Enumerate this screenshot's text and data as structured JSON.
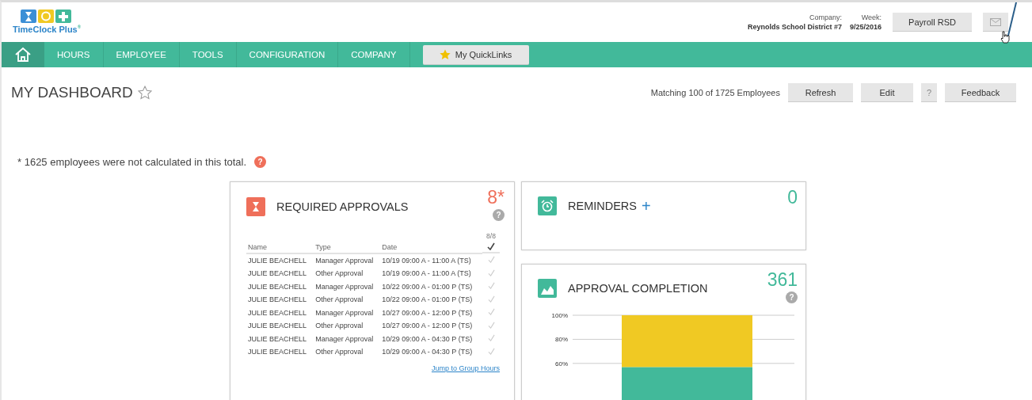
{
  "logo": {
    "text": "TimeClock Plus",
    "mark": "®"
  },
  "header": {
    "company_label": "Company:",
    "company": "Reynolds School District #7",
    "week_label": "Week:",
    "week": "9/25/2016",
    "payroll_button": "Payroll RSD"
  },
  "nav": {
    "items": [
      {
        "label": "HOURS",
        "selected": false
      },
      {
        "label": "EMPLOYEE",
        "selected": false
      },
      {
        "label": "TOOLS",
        "selected": false
      },
      {
        "label": "CONFIGURATION",
        "selected": false
      },
      {
        "label": "COMPANY",
        "selected": false
      }
    ],
    "quicklinks": "My QuickLinks"
  },
  "page": {
    "title": "MY DASHBOARD",
    "matching": "Matching 100 of 1725 Employees",
    "buttons": [
      "Refresh",
      "Edit",
      "?",
      "Feedback"
    ],
    "note": "* 1625 employees were not calculated in this total.",
    "help": "?"
  },
  "approvals": {
    "title": "REQUIRED APPROVALS",
    "count": "8*",
    "help": "?",
    "columns": [
      "Name",
      "Type",
      "Date"
    ],
    "check_count": "8/8",
    "rows": [
      {
        "name": "JULIE BEACHELL",
        "type": "Manager Approval",
        "date": "10/19 09:00 A - 11:00 A (TS)"
      },
      {
        "name": "JULIE BEACHELL",
        "type": "Other Approval",
        "date": "10/19 09:00 A - 11:00 A (TS)"
      },
      {
        "name": "JULIE BEACHELL",
        "type": "Manager Approval",
        "date": "10/22 09:00 A - 01:00 P (TS)"
      },
      {
        "name": "JULIE BEACHELL",
        "type": "Other Approval",
        "date": "10/22 09:00 A - 01:00 P (TS)"
      },
      {
        "name": "JULIE BEACHELL",
        "type": "Manager Approval",
        "date": "10/27 09:00 A - 12:00 P (TS)"
      },
      {
        "name": "JULIE BEACHELL",
        "type": "Other Approval",
        "date": "10/27 09:00 A - 12:00 P (TS)"
      },
      {
        "name": "JULIE BEACHELL",
        "type": "Manager Approval",
        "date": "10/29 09:00 A - 04:30 P (TS)"
      },
      {
        "name": "JULIE BEACHELL",
        "type": "Other Approval",
        "date": "10/29 09:00 A - 04:30 P (TS)"
      }
    ],
    "link": "Jump to Group Hours"
  },
  "reminders": {
    "title": "REMINDERS",
    "add": "+",
    "count": "0"
  },
  "completion": {
    "title": "APPROVAL COMPLETION",
    "count": "361",
    "help": "?",
    "chart_data": {
      "type": "bar",
      "stacked": true,
      "categories": [
        null
      ],
      "ylim": [
        0,
        100
      ],
      "yticks": [
        {
          "value": 100,
          "label": "100%"
        },
        {
          "value": 80,
          "label": "80%"
        },
        {
          "value": 60,
          "label": "60%"
        }
      ],
      "series": [
        {
          "color": "#42b99a",
          "values": [
            57
          ]
        },
        {
          "color": "#f0c923",
          "values": [
            43
          ]
        }
      ]
    }
  }
}
